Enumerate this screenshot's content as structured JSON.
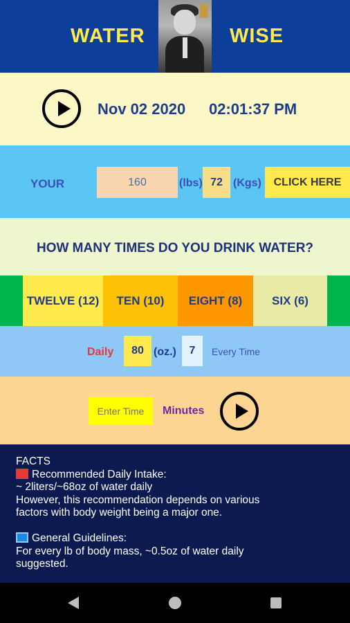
{
  "header": {
    "title_left": "WATER",
    "title_right": "WISE",
    "accent_color": "#ffe94d",
    "background_color": "#0d3f9a"
  },
  "datetime": {
    "date": "Nov 02 2020",
    "time": "02:01:37 PM"
  },
  "weight": {
    "label": "YOUR",
    "lbs_value": "160",
    "lbs_unit": "(lbs)",
    "kg_value": "72",
    "kg_unit": "(Kgs)",
    "button_label": "CLICK HERE"
  },
  "question": "HOW MANY TIMES DO YOU DRINK WATER?",
  "choices": [
    {
      "label": "TWELVE (12)"
    },
    {
      "label": "TEN (10)"
    },
    {
      "label": "EIGHT (8)"
    },
    {
      "label": "SIX (6)"
    }
  ],
  "intake": {
    "daily_label": "Daily",
    "oz_value": "80",
    "oz_unit": "(oz.)",
    "per_time_value": "7",
    "every_label": "Every Time"
  },
  "timer": {
    "placeholder": "Enter Time",
    "minutes_label": "Minutes"
  },
  "facts": {
    "heading": "FACTS",
    "item1_title": "Recommended Daily Intake:",
    "item1_line1": "~ 2liters/~68oz of water daily",
    "item1_line2": "However, this recommendation depends on various",
    "item1_line3": "factors with body weight being a major one.",
    "item2_title": "General Guidelines:",
    "item2_line1": "For every lb of body mass, ~0.5oz of water daily",
    "item2_line2": "suggested."
  }
}
